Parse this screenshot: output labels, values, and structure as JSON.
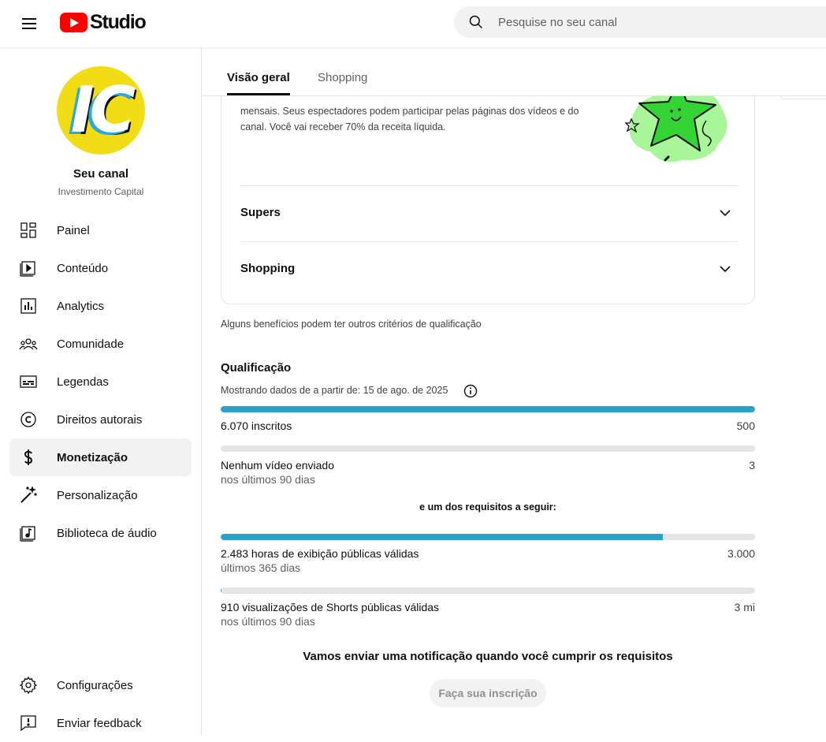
{
  "app": {
    "studio_label": "Studio"
  },
  "search": {
    "placeholder": "Pesquise no seu canal"
  },
  "channel": {
    "avatar_text": "IC",
    "title": "Seu canal",
    "name": "Investimento Capital"
  },
  "sidebar": {
    "items": [
      {
        "label": "Painel",
        "icon": "dashboard-icon"
      },
      {
        "label": "Conteúdo",
        "icon": "content-icon"
      },
      {
        "label": "Analytics",
        "icon": "analytics-icon"
      },
      {
        "label": "Comunidade",
        "icon": "community-icon"
      },
      {
        "label": "Legendas",
        "icon": "subtitles-icon"
      },
      {
        "label": "Direitos autorais",
        "icon": "copyright-icon"
      },
      {
        "label": "Monetização",
        "icon": "dollar-icon",
        "active": true
      },
      {
        "label": "Personalização",
        "icon": "magic-wand-icon"
      },
      {
        "label": "Biblioteca de áudio",
        "icon": "audio-library-icon"
      }
    ],
    "bottom": [
      {
        "label": "Configurações",
        "icon": "gear-icon"
      },
      {
        "label": "Enviar feedback",
        "icon": "feedback-icon"
      }
    ]
  },
  "tabs": [
    {
      "label": "Visão geral",
      "active": true
    },
    {
      "label": "Shopping",
      "active": false
    }
  ],
  "card": {
    "description": "mensais. Seus espectadores podem participar pelas páginas dos vídeos e do canal. Você vai receber 70% da receita líquida.",
    "accordion": [
      {
        "label": "Supers"
      },
      {
        "label": "Shopping"
      }
    ]
  },
  "note": "Alguns benefícios podem ter outros critérios de qualificação",
  "qualification": {
    "title": "Qualificação",
    "date_text": "Mostrando dados de a partir de: 15 de ago. de 2025",
    "requirements": [
      {
        "label": "6.070 inscritos",
        "sub": "",
        "target": "500",
        "progress": 1.0
      },
      {
        "label": "Nenhum vídeo enviado",
        "sub": "nos últimos 90 dias",
        "target": "3",
        "progress": 0.0
      }
    ],
    "or_text": "e um dos requisitos a seguir:",
    "alt_requirements": [
      {
        "label": "2.483 horas de exibição públicas válidas",
        "sub": "últimos 365 dias",
        "target": "3.000",
        "progress": 0.8277
      },
      {
        "label": "910 visualizações de Shorts públicas válidas",
        "sub": "nos últimos 90 dias",
        "target": "3 mi",
        "progress": 0.0003
      }
    ],
    "notify_text": "Vamos enviar uma notificação quando você cumprir os requisitos",
    "subscribe_label": "Faça sua inscrição"
  },
  "colors": {
    "progress_fill": "#2ca2c9",
    "progress_track": "#e5e5e5",
    "youtube_red": "#ff0000",
    "avatar_bg": "#f2dc16",
    "star_green": "#33d433"
  }
}
